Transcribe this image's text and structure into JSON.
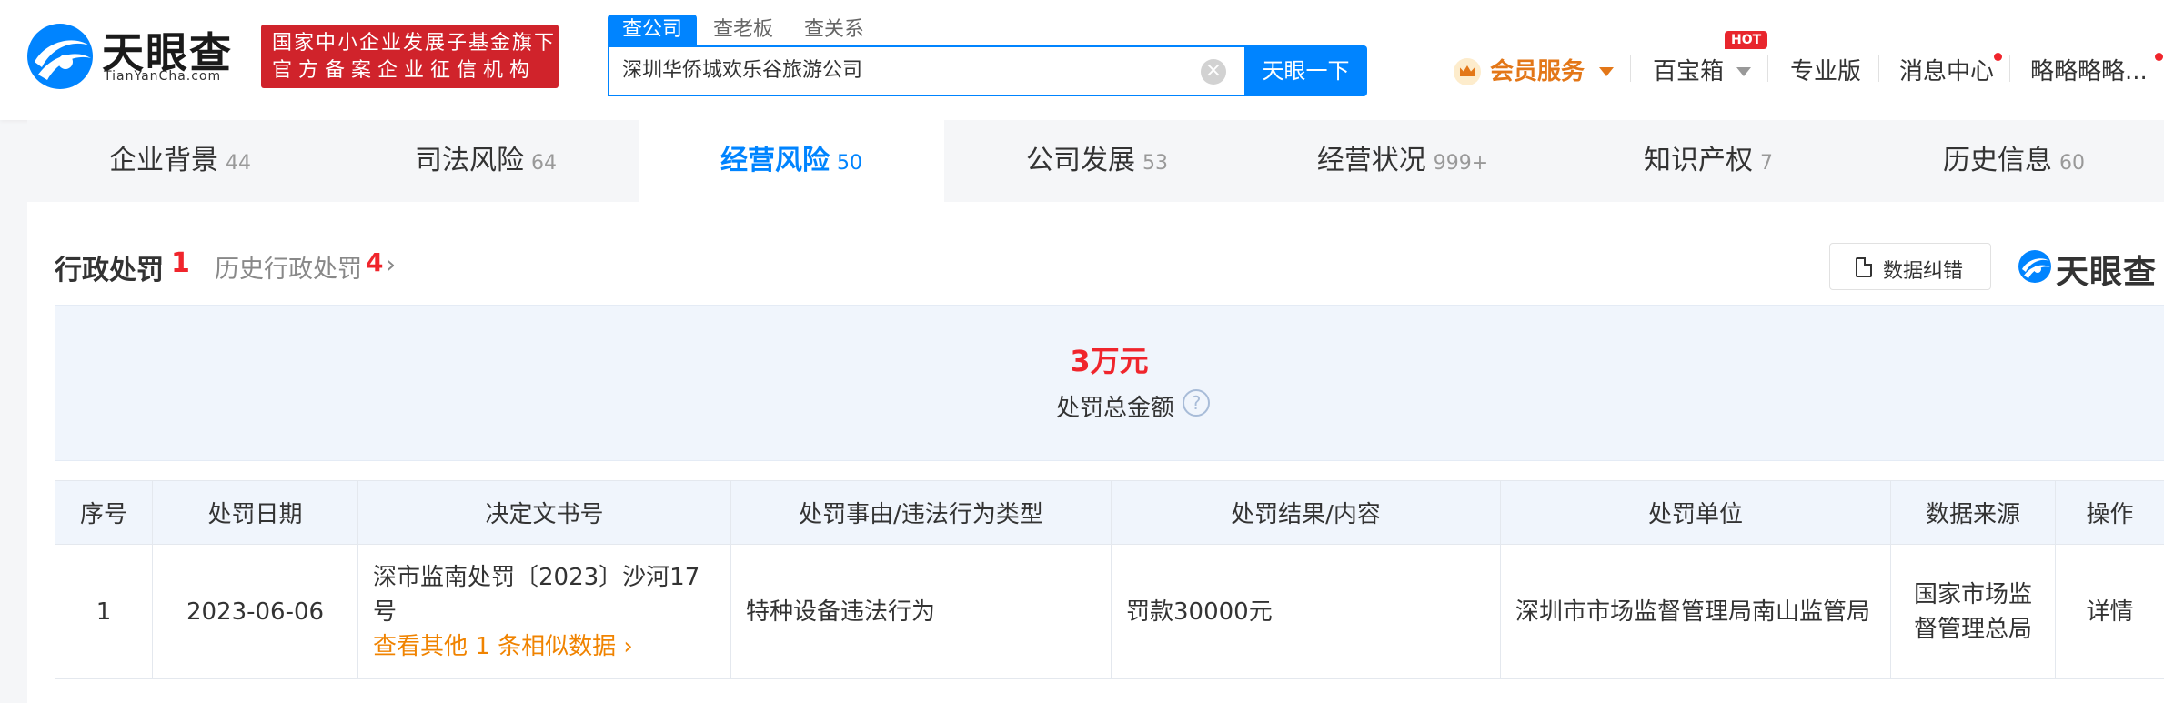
{
  "brand": {
    "name": "天眼查",
    "domain": "TianYanCha.com",
    "badge_line1": "国家中小企业发展子基金旗下",
    "badge_line2": "官方备案企业征信机构"
  },
  "search": {
    "tabs": [
      "查公司",
      "查老板",
      "查关系"
    ],
    "value": "深圳华侨城欢乐谷旅游公司",
    "button": "天眼一下"
  },
  "topnav": {
    "vip": "会员服务",
    "toolbox": "百宝箱",
    "hot": "HOT",
    "pro": "专业版",
    "messages": "消息中心",
    "user": "略略略略..."
  },
  "categories": [
    {
      "label": "企业背景",
      "count": "44"
    },
    {
      "label": "司法风险",
      "count": "64"
    },
    {
      "label": "经营风险",
      "count": "50"
    },
    {
      "label": "公司发展",
      "count": "53"
    },
    {
      "label": "经营状况",
      "count": "999+"
    },
    {
      "label": "知识产权",
      "count": "7"
    },
    {
      "label": "历史信息",
      "count": "60"
    }
  ],
  "section": {
    "title": "行政处罚",
    "count": "1",
    "history_label": "历史行政处罚",
    "history_count": "4",
    "correct_button": "数据纠错",
    "watermark": "天眼查"
  },
  "summary": {
    "value": "3万元",
    "label": "处罚总金额"
  },
  "table": {
    "headers": [
      "序号",
      "处罚日期",
      "决定文书号",
      "处罚事由/违法行为类型",
      "处罚结果/内容",
      "处罚单位",
      "数据来源",
      "操作"
    ],
    "rows": [
      {
        "index": "1",
        "date": "2023-06-06",
        "doc_no": "深市监南处罚〔2023〕沙河17号",
        "similar_link": "查看其他 1 条相似数据",
        "reason": "特种设备违法行为",
        "result": "罚款30000元",
        "unit": "深圳市市场监督管理局南山监管局",
        "source": "国家市场监督管理总局",
        "action": "详情"
      }
    ]
  },
  "colors": {
    "accent": "#0084ff",
    "red": "#f0252c",
    "orange": "#f08300",
    "brand_red": "#d0232b"
  }
}
